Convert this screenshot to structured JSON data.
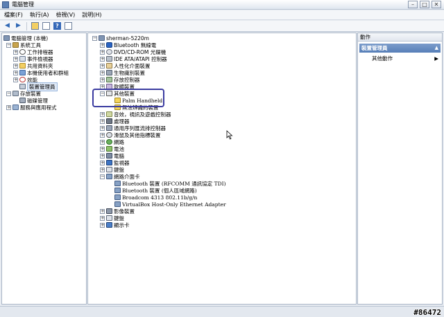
{
  "window": {
    "title": "電腦管理",
    "buttons": {
      "minimize": "–",
      "maximize": "□",
      "close": "✕"
    }
  },
  "menu": [
    "檔案(F)",
    "執行(A)",
    "檢視(V)",
    "說明(H)"
  ],
  "left_tree": {
    "root": "電腦管理 (本機)",
    "items": [
      {
        "label": "系統工具",
        "icon": "tools-icon"
      },
      {
        "label": "工作排程器",
        "icon": "clock-icon"
      },
      {
        "label": "事件檢視器",
        "icon": "event-viewer-icon"
      },
      {
        "label": "共用資料夾",
        "icon": "folder-icon"
      },
      {
        "label": "本機使用者和群組",
        "icon": "users-icon"
      },
      {
        "label": "效能",
        "icon": "performance-icon"
      },
      {
        "label": "裝置管理員",
        "icon": "device-manager-icon"
      },
      {
        "label": "存放裝置",
        "icon": "storage-icon"
      },
      {
        "label": "磁碟管理",
        "icon": "disk-icon"
      },
      {
        "label": "服務與應用程式",
        "icon": "services-icon"
      }
    ]
  },
  "device_tree": {
    "root": "sherman-5220m",
    "items": [
      {
        "label": "Bluetooth 無線電",
        "icon": "bluetooth-icon"
      },
      {
        "label": "DVD/CD-ROM 光碟機",
        "icon": "dvd-icon"
      },
      {
        "label": "IDE ATA/ATAPI 控制器",
        "icon": "ide-controller-icon"
      },
      {
        "label": "人性化介面裝置",
        "icon": "hid-icon"
      },
      {
        "label": "生物識別裝置",
        "icon": "biometric-icon"
      },
      {
        "label": "存放控制器",
        "icon": "storage-controller-icon"
      },
      {
        "label": "軟體裝置",
        "icon": "software-device-icon"
      },
      {
        "label": "其他裝置",
        "icon": "other-devices-icon"
      },
      {
        "label": "Palm Handheld",
        "icon": "warning-device-icon"
      },
      {
        "label": "無法辨識的裝置",
        "icon": "warning-device-icon"
      },
      {
        "label": "音效，視訊及遊戲控制器",
        "icon": "audio-icon"
      },
      {
        "label": "處理器",
        "icon": "processor-icon"
      },
      {
        "label": "通用序列匯流排控制器",
        "icon": "usb-icon"
      },
      {
        "label": "滑鼠及其他指標裝置",
        "icon": "mouse-icon"
      },
      {
        "label": "網路",
        "icon": "network-globe-icon"
      },
      {
        "label": "電池",
        "icon": "battery-icon"
      },
      {
        "label": "電腦",
        "icon": "computer-icon"
      },
      {
        "label": "監視器",
        "icon": "monitor-icon"
      },
      {
        "label": "鍵盤",
        "icon": "keyboard-icon"
      },
      {
        "label": "網路介面卡",
        "icon": "network-adapter-icon"
      },
      {
        "label": "Bluetooth 裝置 (RFCOMM 通訊協定 TDI)",
        "icon": "network-adapter-icon"
      },
      {
        "label": "Bluetooth 裝置 (個人區域網路)",
        "icon": "network-adapter-icon"
      },
      {
        "label": "Broadcom 4313 802.11b/g/n",
        "icon": "network-adapter-icon"
      },
      {
        "label": "VirtualBox Host-Only Ethernet Adapter",
        "icon": "network-adapter-icon"
      },
      {
        "label": "影像裝置",
        "icon": "imaging-icon"
      },
      {
        "label": "鍵盤",
        "icon": "keyboard-icon"
      },
      {
        "label": "顯示卡",
        "icon": "display-adapter-icon"
      }
    ]
  },
  "actions": {
    "header": "動作",
    "section": "裝置管理員",
    "item": "其他動作",
    "more_arrow": "▶",
    "collapse_arrow": "▲"
  },
  "watermark": "#86472"
}
